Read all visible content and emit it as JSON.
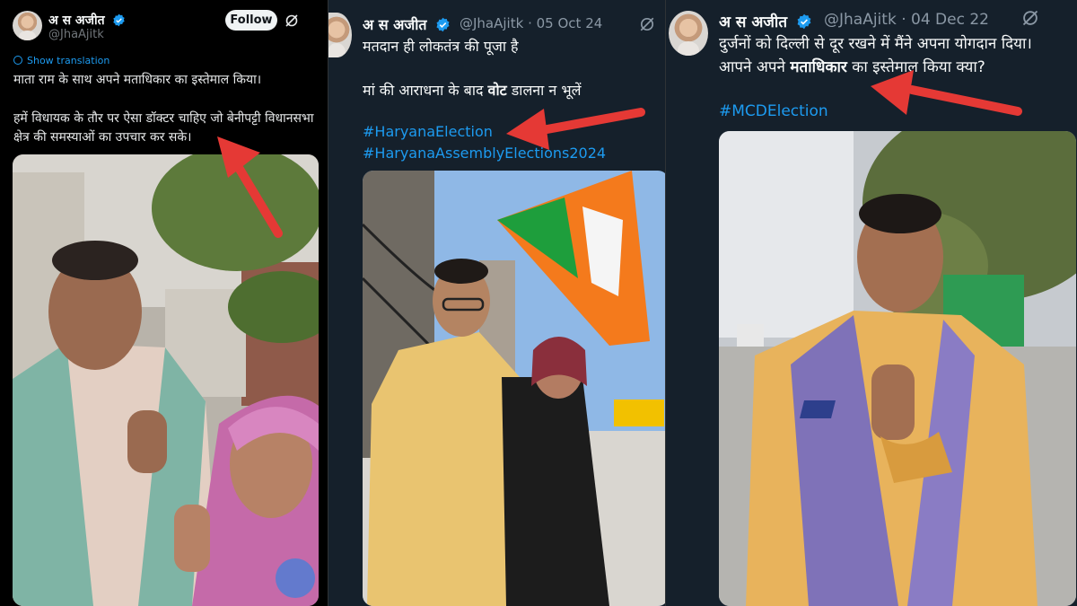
{
  "tweet1": {
    "author_name": "अ स अजीत",
    "handle": "@JhaAjitk",
    "follow_label": "Follow",
    "show_translation": "Show translation",
    "line1": "माता राम के साथ अपने मताधिकार का इस्तेमाल किया।",
    "line2": "हमें विधायक के तौर पर ऐसा डॉक्टर चाहिए जो बेनीपट्टी विधानसभा",
    "line3": "क्षेत्र की समस्याओं का उपचार कर सके।"
  },
  "tweet2": {
    "author_name": "अ स अजीत",
    "handle": "@JhaAjitk",
    "separator": "·",
    "date": "05 Oct 24",
    "line1": "मतदान ही लोकतंत्र की पूजा है",
    "line2_prefix": "मां की आराधना के बाद ",
    "line2_bold": "वोट",
    "line2_suffix": " डालना न भूलें",
    "hashtag1": "#HaryanaElection",
    "hashtag2": "#HaryanaAssemblyElections2024"
  },
  "tweet3": {
    "author_name": "अ स अजीत",
    "handle": "@JhaAjitk",
    "separator": "·",
    "date": "04 Dec 22",
    "line1": "दुर्जनों को दिल्ली से दूर रखने में मैंने अपना योगदान दिया।",
    "line2_prefix": "आपने अपने ",
    "line2_bold": "मताधिकार",
    "line2_suffix": " का इस्तेमाल किया क्या?",
    "hashtag1": "#MCDElection"
  },
  "colors": {
    "link": "#1d9bf0",
    "verified": "#1d9bf0",
    "annotation_arrow": "#e53935",
    "dim_bg": "#15202b",
    "black_bg": "#000000"
  },
  "icons": [
    "verified-badge-icon",
    "grok-icon",
    "globe-icon",
    "annotation-arrow",
    "chat-bubble-icon"
  ]
}
